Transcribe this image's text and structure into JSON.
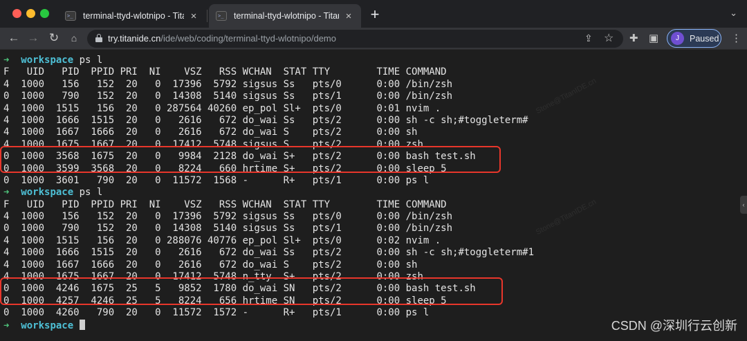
{
  "tabs": [
    {
      "favicon": ">_",
      "title": "terminal-ttyd-wlotnipo - TitanIDE",
      "close": "×",
      "active": false
    },
    {
      "favicon": ">_",
      "title": "terminal-ttyd-wlotnipo - TitanIDE",
      "close": "×",
      "active": true
    }
  ],
  "new_tab_label": "+",
  "tab_menu_icon": "chevron-down-icon",
  "toolbar": {
    "back_icon": "←",
    "forward_icon": "→",
    "reload_icon": "↻",
    "url_host": "try.titanide.cn",
    "url_path": "/ide/web/coding/terminal-ttyd-wlotnipo/demo",
    "share_icon": "⇪",
    "bookmark_icon": "☆",
    "extensions_icon": "✚",
    "sidepanel_icon": "▣",
    "avatar_letter": "J",
    "status_label": "Paused",
    "menu_icon": "⋮"
  },
  "terminal": {
    "prompt_arrow": "➜",
    "prompt_dir": "workspace",
    "command_1": " ps l",
    "command_2": " ps l",
    "output_1": [
      "F   UID   PID  PPID PRI  NI    VSZ   RSS WCHAN  STAT TTY        TIME COMMAND",
      "4  1000   156   152  20   0  17396  5792 sigsus Ss   pts/0      0:00 /bin/zsh",
      "0  1000   790   152  20   0  14308  5140 sigsus Ss   pts/1      0:00 /bin/zsh",
      "4  1000  1515   156  20   0 287564 40260 ep_pol Sl+  pts/0      0:01 nvim .",
      "4  1000  1666  1515  20   0   2616   672 do_wai Ss   pts/2      0:00 sh -c sh;#toggleterm#",
      "4  1000  1667  1666  20   0   2616   672 do_wai S    pts/2      0:00 sh",
      "4  1000  1675  1667  20   0  17412  5748 sigsus S    pts/2      0:00 zsh",
      "0  1000  3568  1675  20   0   9984  2128 do_wai S+   pts/2      0:00 bash test.sh",
      "0  1000  3599  3568  20   0   8224   660 hrtime S+   pts/2      0:00 sleep 5",
      "0  1000  3601   790  20   0  11572  1568 -      R+   pts/1      0:00 ps l"
    ],
    "output_2": [
      "F   UID   PID  PPID PRI  NI    VSZ   RSS WCHAN  STAT TTY        TIME COMMAND",
      "4  1000   156   152  20   0  17396  5792 sigsus Ss   pts/0      0:00 /bin/zsh",
      "0  1000   790   152  20   0  14308  5140 sigsus Ss   pts/1      0:00 /bin/zsh",
      "4  1000  1515   156  20   0 288076 40776 ep_pol Sl+  pts/0      0:02 nvim .",
      "4  1000  1666  1515  20   0   2616   672 do_wai Ss   pts/2      0:00 sh -c sh;#toggleterm#1",
      "4  1000  1667  1666  20   0   2616   672 do_wai S    pts/2      0:00 sh",
      "4  1000  1675  1667  20   0  17412  5748 n_tty  S+   pts/2      0:00 zsh",
      "0  1000  4246  1675  25   5   9852  1780 do_wai SN   pts/2      0:00 bash test.sh",
      "0  1000  4257  4246  25   5   8224   656 hrtime SN   pts/2      0:00 sleep 5",
      "0  1000  4260   790  20   0  11572  1572 -      R+   pts/1      0:00 ps l"
    ]
  },
  "watermark_text": "Stone@TitanIDE.cn",
  "csdn_watermark": "CSDN @深圳行云创新",
  "colors": {
    "tab_bg": "#202124",
    "active_tab": "#35363a",
    "terminal_bg": "#1e1e1e",
    "prompt_green": "#4ec27a",
    "prompt_cyan": "#4ec0d6",
    "highlight_red": "#e8362b",
    "paused_blue": "#8ab4f8"
  }
}
